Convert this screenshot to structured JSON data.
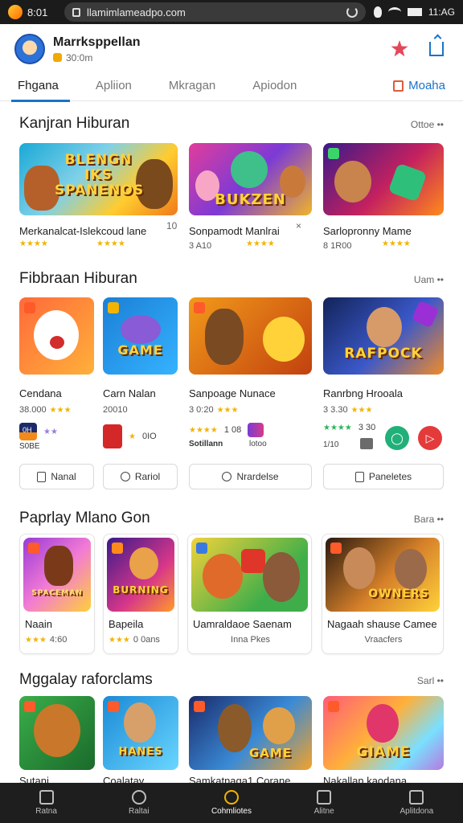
{
  "status": {
    "time": "8:01",
    "url": "llamimlameadpo.com",
    "right": "11:AG"
  },
  "header": {
    "title": "Marrksppellan",
    "sub": "30:0m"
  },
  "tabs": [
    "Fhgana",
    "Apliion",
    "Mkragan",
    "Apiodon"
  ],
  "tab_right": "Moaha",
  "sections": {
    "s1": {
      "title": "Kanjran Hiburan",
      "more": "Ottoe ••"
    },
    "s2": {
      "title": "Fibbraan Hiburan",
      "more": "Uam ••"
    },
    "s3": {
      "title": "Paprlay Mlano Gon",
      "more": "Bara ••"
    },
    "s4": {
      "title": "Mggalay raforclams",
      "more": "Sarl ••"
    }
  },
  "row1": [
    {
      "title": "Merkanalcat-Islekcoud lane",
      "meta": "",
      "art": "BLENGN IKS SPANENOS"
    },
    {
      "title": "Sonpamodt Manlrai",
      "meta": "3 A10",
      "art": "BUKZEN"
    },
    {
      "title": "Sarlopronny Mame",
      "meta": "8 1R00",
      "art": ""
    }
  ],
  "row1_extra": {
    "num1": "10",
    "num2": "×"
  },
  "row2": [
    {
      "title": "Cendana",
      "meta": "38.000",
      "art": ""
    },
    {
      "title": "Carn Nalan",
      "meta": "20010",
      "art": "GAME"
    },
    {
      "title": "Sanpoage Nunace",
      "meta": "3 0:20",
      "art": ""
    },
    {
      "title": "Ranrbng Hrooala",
      "meta": "3 3.30",
      "art": "RAFPOCK"
    }
  ],
  "mini": {
    "a": "0H",
    "a2": "S0BE",
    "b": "0IO",
    "c": "1 08",
    "c2": "Sotillann",
    "c3": "lotoo",
    "d": "3 30",
    "d2": "1/10"
  },
  "chips": [
    "Nanal",
    "Rariol",
    "Nrardelse",
    "Paneletes"
  ],
  "row3": [
    {
      "title": "Naain",
      "meta": "4:60",
      "art": "SPACEMAN"
    },
    {
      "title": "Bapeila",
      "meta": "0 0ans",
      "art": "BURNING"
    },
    {
      "title": "Uamraldaoe Saenam",
      "meta": "Inna Pkes",
      "art": ""
    },
    {
      "title": "Nagaah shause Camee",
      "meta": "Vraacfers",
      "art": "OWNERS"
    }
  ],
  "row4": [
    {
      "title": "Sutani",
      "art": ""
    },
    {
      "title": "Coalatay",
      "art": "HANES"
    },
    {
      "title": "Samkatnaga1 Corane",
      "art": "GAME"
    },
    {
      "title": "Nakallan kaodana",
      "art": "GIAME"
    }
  ],
  "nav": [
    "Ratna",
    "Raltai",
    "Cohmliotes",
    "Alitne",
    "Aplitdona"
  ],
  "colors": {
    "accent": "#1a73c8",
    "star": "#f2b400",
    "nav_bg": "#1e1e1e"
  }
}
